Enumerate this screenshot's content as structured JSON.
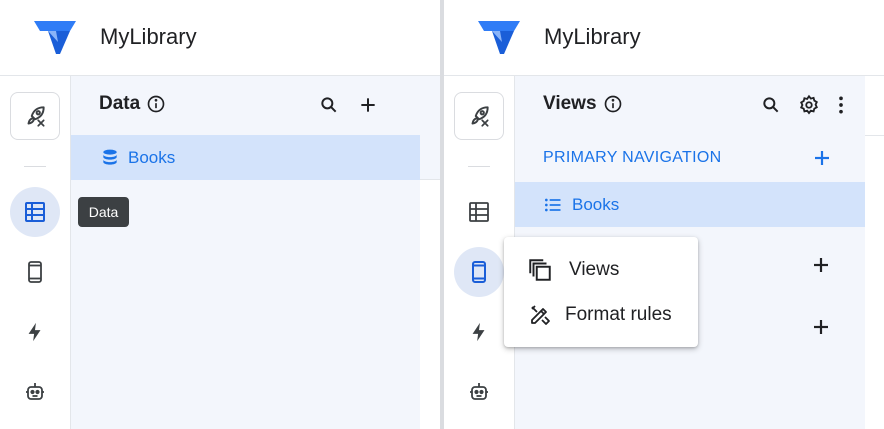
{
  "left_panel": {
    "app_title": "MyLibrary",
    "section_title": "Data",
    "tables": [
      {
        "label": "Books"
      }
    ],
    "tooltip": "Data"
  },
  "right_panel": {
    "app_title": "MyLibrary",
    "section_title": "Views",
    "primary_navigation_label": "PRIMARY NAVIGATION",
    "views": [
      {
        "label": "Books"
      }
    ],
    "menu": {
      "items": [
        {
          "label": "Views",
          "icon": "copy-icon"
        },
        {
          "label": "Format rules",
          "icon": "format-rules-icon"
        }
      ]
    }
  },
  "colors": {
    "accent": "#1a73e8",
    "selected_bg": "#d3e3fb",
    "content_bg": "#f3f6fc",
    "active_rail_bg": "#dfe7f6",
    "tooltip_bg": "#3c4043"
  }
}
